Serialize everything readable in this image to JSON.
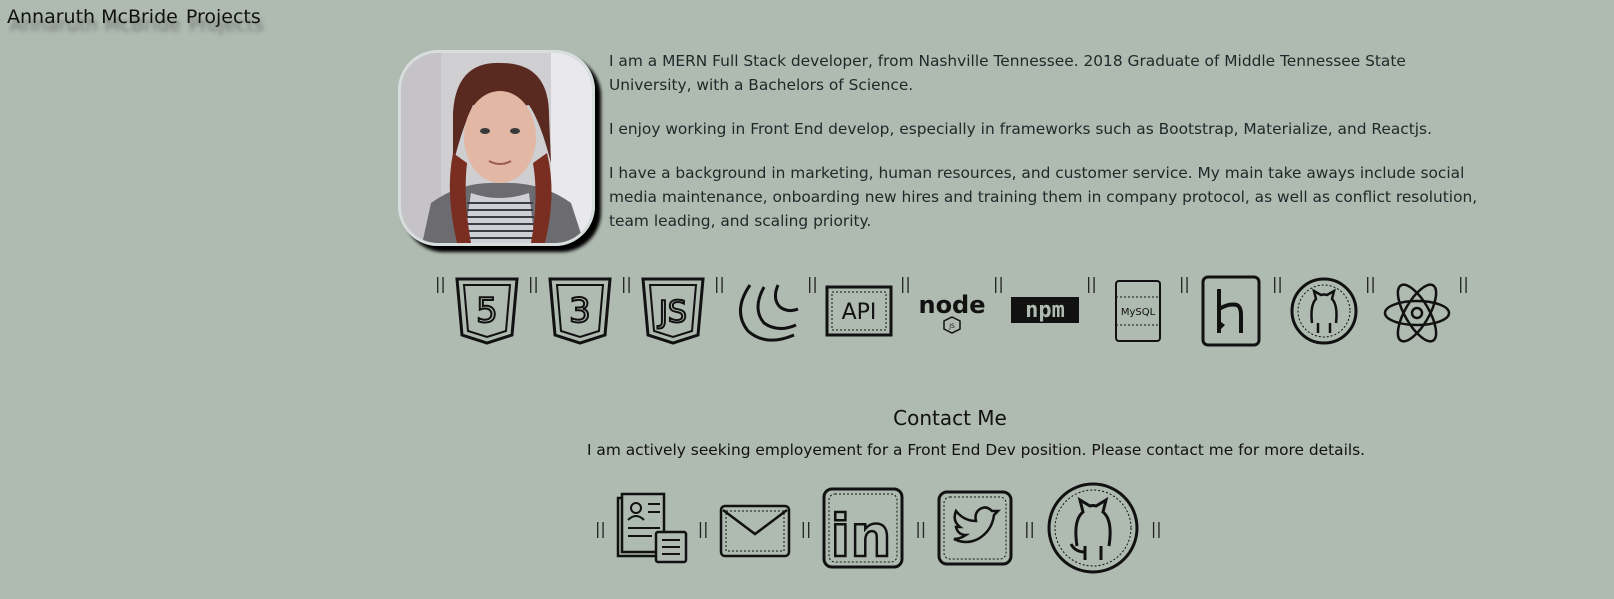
{
  "nav": {
    "name": "Annaruth McBride",
    "projects": "Projects"
  },
  "about": {
    "p1": "I am a MERN Full Stack developer, from Nashville Tennessee. 2018 Graduate of Middle Tennessee State University, with a Bachelors of Science.",
    "p2": "I enjoy working in Front End develop, especially in frameworks such as Bootstrap, Materialize, and Reactjs.",
    "p3": "I have a background in marketing, human resources, and customer service. My main take aways include social media maintenance, onboarding new hires and training them in company protocol, as well as conflict resolution, team leading, and scaling priority."
  },
  "separator": "||",
  "skills": {
    "html5": "5",
    "css3": "3",
    "js": "JS",
    "api": "API",
    "node": "node",
    "node_sub": "JS",
    "npm": "npm",
    "mysql": "MySQL"
  },
  "contact": {
    "title": "Contact Me",
    "text": "I am actively seeking employement for a Front End Dev position. Please contact me for more details.",
    "linkedin": "in"
  },
  "colors": {
    "background": "#afbab1",
    "text": "#1e292a",
    "icon": "#111111"
  }
}
